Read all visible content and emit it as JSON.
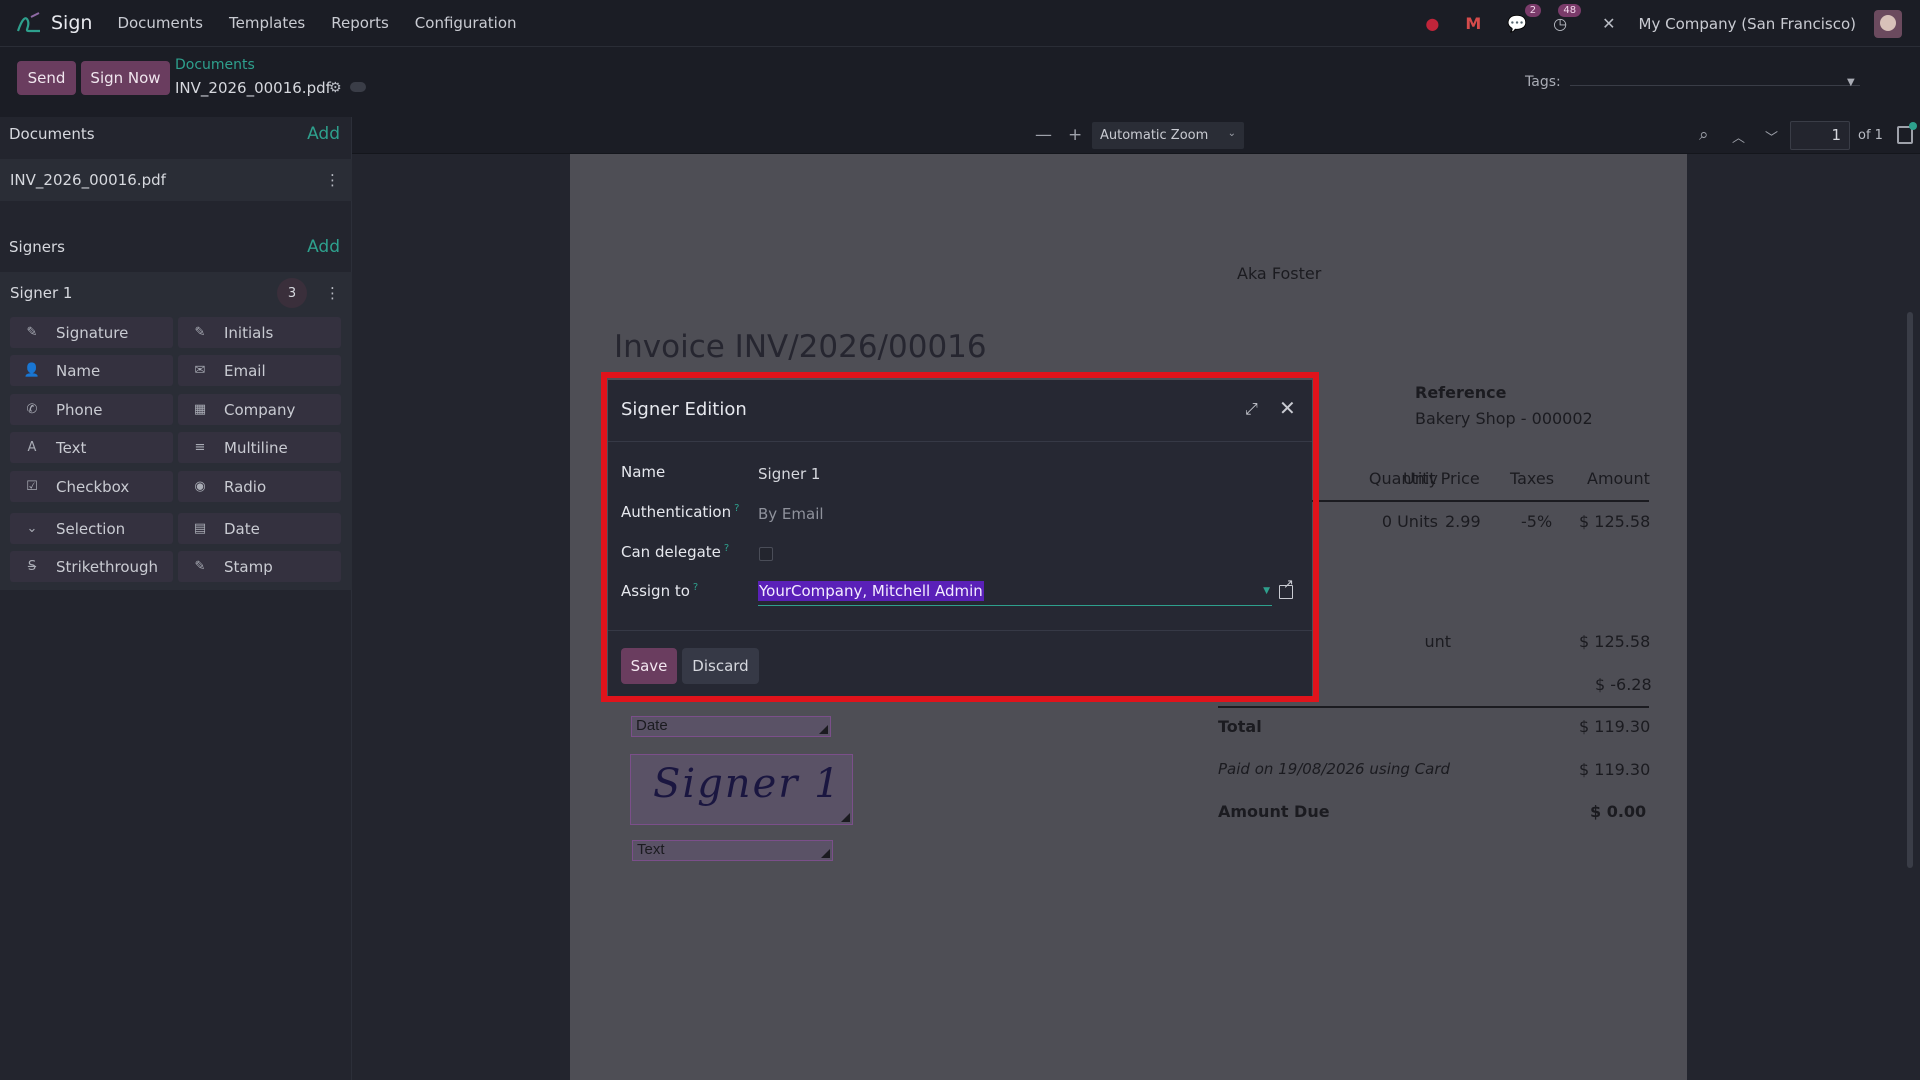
{
  "navbar": {
    "brand": "Sign",
    "menu": [
      "Documents",
      "Templates",
      "Reports",
      "Configuration"
    ],
    "chat_badge": "2",
    "activity_badge": "48",
    "company": "My Company (San Francisco)"
  },
  "control": {
    "send_label": "Send",
    "sign_now_label": "Sign Now",
    "breadcrumb_parent": "Documents",
    "breadcrumb_current": "INV_2026_00016.pdf",
    "tags_label": "Tags:"
  },
  "sidebar": {
    "documents_title": "Documents",
    "documents_add": "Add",
    "document_name": "INV_2026_00016.pdf",
    "signers_title": "Signers",
    "signers_add": "Add",
    "signer_name": "Signer 1",
    "signer_count": "3",
    "fields": [
      {
        "label": "Signature",
        "icon": "✎"
      },
      {
        "label": "Initials",
        "icon": "✎"
      },
      {
        "label": "Name",
        "icon": "👤"
      },
      {
        "label": "Email",
        "icon": "✉"
      },
      {
        "label": "Phone",
        "icon": "✆"
      },
      {
        "label": "Company",
        "icon": "▦"
      },
      {
        "label": "Text",
        "icon": "A"
      },
      {
        "label": "Multiline",
        "icon": "≡"
      },
      {
        "label": "Checkbox",
        "icon": "☑"
      },
      {
        "label": "Radio",
        "icon": "◉"
      },
      {
        "label": "Selection",
        "icon": "⌄"
      },
      {
        "label": "Date",
        "icon": "▤"
      },
      {
        "label": "Strikethrough",
        "icon": "S̶"
      },
      {
        "label": "Stamp",
        "icon": "✎"
      }
    ]
  },
  "viewer": {
    "zoom": "Automatic Zoom",
    "page_number": "1",
    "page_total": "of 1"
  },
  "invoice": {
    "customer": "Aka Foster",
    "title": "Invoice INV/2026/00016",
    "reference_label": "Reference",
    "reference_value": "Bakery Shop - 000002",
    "col_quantity": "Quantity",
    "col_unit_price": "Unit Price",
    "col_taxes": "Taxes",
    "col_amount": "Amount",
    "row_qty": "0 Units",
    "row_price": "2.99",
    "row_tax": "-5%",
    "row_amount": "$ 125.58",
    "untaxed_label_partial": "unt",
    "untaxed_value": "$ 125.58",
    "tax_value": "$ -6.28",
    "total_label": "Total",
    "total_value": "$ 119.30",
    "paid_label": "Paid on 19/08/2026 using Card",
    "paid_value": "$ 119.30",
    "due_label": "Amount Due",
    "due_value": "$ 0.00"
  },
  "pdf_fields": {
    "date_label": "Date",
    "signature_text": "Signer 1",
    "text_label": "Text"
  },
  "dialog": {
    "title": "Signer Edition",
    "name_label": "Name",
    "name_value": "Signer 1",
    "auth_label": "Authentication",
    "auth_value": "By Email",
    "delegate_label": "Can delegate",
    "assign_label": "Assign to",
    "assign_value": "YourCompany, Mitchell Admin",
    "save_label": "Save",
    "discard_label": "Discard",
    "help_mark": "?"
  }
}
